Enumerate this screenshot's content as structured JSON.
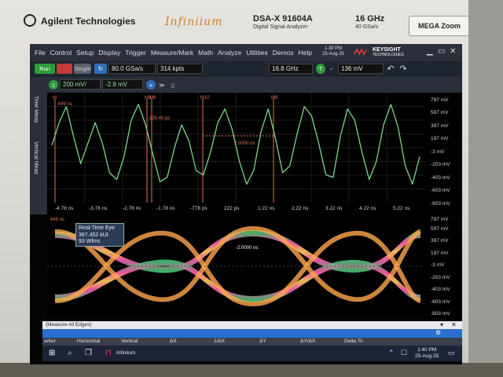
{
  "bezel": {
    "brand": "Agilent Technologies",
    "series": "Infiniium",
    "model": "DSA-X 91604A",
    "model_sub": "Digital Signal Analyzer",
    "bandwidth": "16 GHz",
    "sample_rate_spec": "40 GSa/s",
    "badge": "MEGA Zoom"
  },
  "menu": {
    "items": [
      "File",
      "Control",
      "Setup",
      "Display",
      "Trigger",
      "Measure/Mark",
      "Math",
      "Analyze",
      "Utilities",
      "Demos",
      "Help"
    ],
    "clock_time": "1:39 PM",
    "clock_date": "25-Aug-25",
    "keysight_line1": "KEYSIGHT",
    "keysight_line2": "TECHNOLOGIES"
  },
  "toolbar": {
    "run_label": "Run",
    "single_label": "Single",
    "sample_rate": "80.0 GSa/s",
    "memory_depth": "314 kpts",
    "bandwidth": "16.8 GHz",
    "trigger_level": "136 mV"
  },
  "channel": {
    "scale": "200 mV/",
    "offset": "-2.9 mV"
  },
  "side_tabs": [
    "Time Meas",
    "Vertical Meas"
  ],
  "waveform": {
    "marker_labels": [
      "M",
      "M3",
      "M6",
      "M10",
      "M8"
    ],
    "readout_left": "649 ns",
    "readout_mid": "-135.40 ps",
    "readout_center": "2.0000 ns",
    "time_ticks": [
      "-4.78 ns",
      "-3.78 ns",
      "-2.78 ns",
      "-1.78 ns",
      "-778 ps",
      "222 ps",
      "1.22 ns",
      "2.22 ns",
      "3.22 ns",
      "4.22 ns",
      "5.22 ns"
    ],
    "volt_ticks": [
      "797 mV",
      "597 mV",
      "397 mV",
      "197 mV",
      "-3 mV",
      "-203 mV",
      "-403 mV",
      "-603 mV",
      "-803 mV"
    ],
    "samples": [
      0.05,
      0.55,
      0.9,
      0.25,
      -0.35,
      0.1,
      0.55,
      0.1,
      -0.55,
      -0.7,
      -0.2,
      0.6,
      0.95,
      0.5,
      -0.15,
      -0.75,
      -0.65,
      0.0,
      0.5,
      0.15,
      -0.5,
      -0.6,
      -0.1,
      0.55,
      0.85,
      0.4,
      -0.3,
      -0.8,
      -0.5,
      0.35,
      0.85,
      0.2,
      -0.55,
      -0.4,
      0.3,
      0.9,
      0.7,
      0.1,
      -0.6,
      -0.65,
      0.25,
      0.85,
      0.6,
      -0.1,
      -0.7,
      -0.3,
      0.5,
      0.95,
      0.45,
      -0.4,
      -0.8,
      -0.2
    ]
  },
  "eye": {
    "title": "Real-Time Eye",
    "ui_count": "387.452 kUI",
    "wfms": "93 Wfms",
    "readout_left": "649 ns",
    "readout_center": "-2.0000 ns",
    "volt_ticks": [
      "797 mV",
      "597 mV",
      "397 mV",
      "197 mV",
      "-3 mV",
      "-203 mV",
      "-403 mV",
      "-603 mV",
      "-803 mV"
    ]
  },
  "measure_bar": {
    "label": "(Measure All Edges)"
  },
  "bottom_tabs": [
    "arker",
    "Horizontal",
    "Vertical",
    "ΔX",
    "1/ΔX",
    "ΔY",
    "ΔY/ΔX",
    "Delta To"
  ],
  "taskbar": {
    "app_label": "Infiniium",
    "time": "1:40 PM",
    "date": "25-Aug-25"
  },
  "colors": {
    "trace": "#7fd38a",
    "marker": "#e0745a",
    "eye_hot": "#ffd15a",
    "eye_mid": "#ff5ab4",
    "eye_low": "#2ad36a",
    "accent": "#2b6fd0"
  }
}
